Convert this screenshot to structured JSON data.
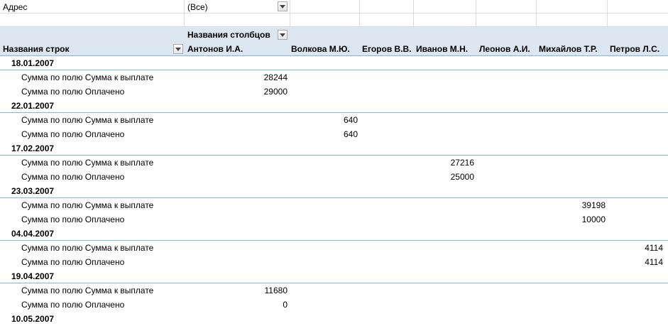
{
  "filter": {
    "label": "Адрес",
    "value": "(Все)"
  },
  "pivot": {
    "col_header_label": "Названия столбцов",
    "row_header_label": "Названия строк",
    "columns": [
      "Антонов И.А.",
      "Волкова М.Ю.",
      "Егоров В.В.",
      "Иванов М.Н.",
      "Леонов А.И.",
      "Михайлов Т.Р.",
      "Петров Л.С."
    ],
    "groups": [
      {
        "date": "18.01.2007",
        "sum_due_label": "Сумма по полю Сумма к выплате",
        "sum_due": "28244",
        "paid_label": "Сумма по полю Оплачено",
        "paid": "29000"
      },
      {
        "date": "22.01.2007",
        "sum_due_label": "Сумма по полю Сумма к выплате",
        "sum_due": "640",
        "paid_label": "Сумма по полю Оплачено",
        "paid": "640"
      },
      {
        "date": "17.02.2007",
        "sum_due_label": "Сумма по полю Сумма к выплате",
        "sum_due": "27216",
        "paid_label": "Сумма по полю Оплачено",
        "paid": "25000"
      },
      {
        "date": "23.03.2007",
        "sum_due_label": "Сумма по полю Сумма к выплате",
        "sum_due": "39198",
        "paid_label": "Сумма по полю Оплачено",
        "paid": "10000"
      },
      {
        "date": "04.04.2007",
        "sum_due_label": "Сумма по полю Сумма к выплате",
        "sum_due": "4114",
        "paid_label": "Сумма по полю Оплачено",
        "paid": "4114"
      },
      {
        "date": "19.04.2007",
        "sum_due_label": "Сумма по полю Сумма к выплате",
        "sum_due": "11680",
        "paid_label": "Сумма по полю Оплачено",
        "paid": "0"
      },
      {
        "date": "10.05.2007"
      }
    ]
  },
  "icons": {
    "filter": "dropdown-arrow-icon"
  },
  "colors": {
    "header_band": "#dce6f1",
    "row_line": "#95b3d7"
  }
}
